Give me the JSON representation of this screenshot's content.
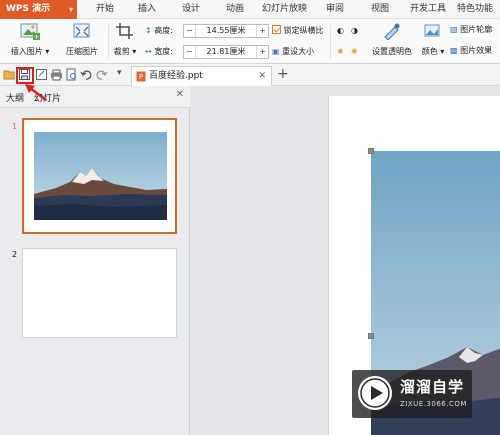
{
  "app": {
    "title": "WPS 演示",
    "accent": "#e05a28"
  },
  "menu": [
    "开始",
    "插入",
    "设计",
    "动画",
    "幻灯片放映",
    "审阅",
    "视图",
    "开发工具",
    "特色功能"
  ],
  "ribbon": {
    "insert_picture": "插入图片",
    "compress_picture": "压缩图片",
    "crop": "裁剪",
    "height_label": "高度:",
    "height_value": "14.55厘米",
    "width_label": "宽度:",
    "width_value": "21.81厘米",
    "lock_ratio": "锁定纵横比",
    "reset_size": "重设大小",
    "set_transparent": "设置透明色",
    "color": "颜色",
    "picture_outline": "图片轮廓",
    "picture_effect": "图片效果"
  },
  "doc_tab": {
    "name": "百度经验.ppt"
  },
  "panel": {
    "outline_tab": "大纲",
    "slides_tab": "幻灯片",
    "slide_numbers": [
      "1",
      "2"
    ]
  },
  "watermark": {
    "brand": "溜溜自学",
    "url": "ZIXUE.3066.COM"
  },
  "colors": {
    "highlight": "#e02020",
    "active_slide_border": "#d06a2a"
  }
}
